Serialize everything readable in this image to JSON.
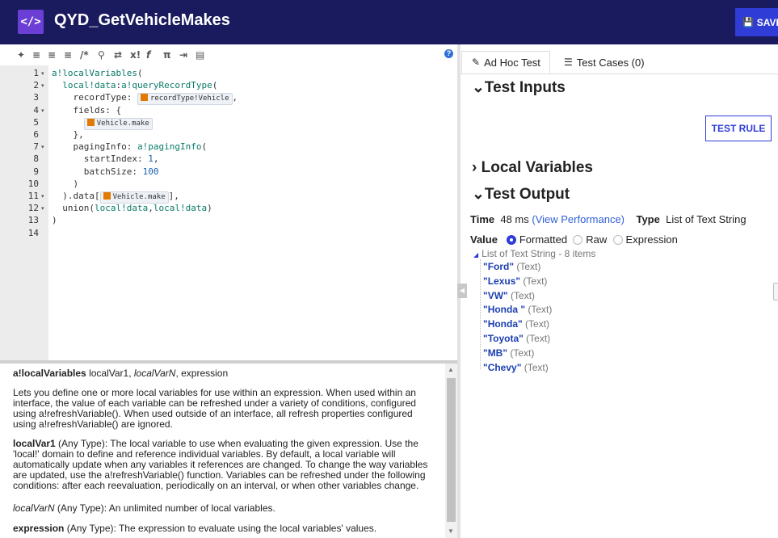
{
  "header": {
    "logo_glyph": "</>",
    "title": "QYD_GetVehicleMakes",
    "save_label": "SAVE"
  },
  "toolbar": {
    "icons": [
      "magic-wand-icon",
      "indent-icon",
      "outdent-icon",
      "list-icon",
      "comment-icon",
      "search-icon",
      "shuffle-icon",
      "variable-icon",
      "function-icon",
      "pi-icon",
      "import-icon",
      "query-icon",
      "help-icon"
    ],
    "help_glyph": "?"
  },
  "editor": {
    "lines": [
      {
        "num": "1",
        "fold": true,
        "text": "a!localVariables("
      },
      {
        "num": "2",
        "fold": true,
        "text": "  local!data:a!queryRecordType("
      },
      {
        "num": "3",
        "fold": false,
        "text": "    recordType: ",
        "chip": "recordType!Vehicle",
        "after": ","
      },
      {
        "num": "4",
        "fold": true,
        "text": "    fields: {"
      },
      {
        "num": "5",
        "fold": false,
        "text": "      ",
        "chip": "Vehicle.make",
        "after": ""
      },
      {
        "num": "6",
        "fold": false,
        "text": "    },"
      },
      {
        "num": "7",
        "fold": true,
        "text": "    pagingInfo: a!pagingInfo("
      },
      {
        "num": "8",
        "fold": false,
        "text": "      startIndex: 1,"
      },
      {
        "num": "9",
        "fold": false,
        "text": "      batchSize: 100"
      },
      {
        "num": "10",
        "fold": false,
        "text": "    )"
      },
      {
        "num": "11",
        "fold": true,
        "text": "  ).data[",
        "chip": "Vehicle.make",
        "after": "],"
      },
      {
        "num": "12",
        "fold": true,
        "text": "  union(local!data,local!data)"
      },
      {
        "num": "13",
        "fold": false,
        "text": ")"
      },
      {
        "num": "14",
        "fold": false,
        "text": ""
      }
    ]
  },
  "docs": {
    "sig_name": "a!localVariables",
    "sig_args": " localVar1, ",
    "sig_italic": "localVarN",
    "sig_rest": ", expression",
    "p1": "Lets you define one or more local variables for use within an expression. When used within an interface, the value of each variable can be refreshed under a variety of conditions, configured using a!refreshVariable(). When used outside of an interface, all refresh properties configured using a!refreshVariable() are ignored.",
    "p2_name": "localVar1",
    "p2": " (Any Type): The local variable to use when evaluating the given expression. Use the 'local!' domain to define and reference individual variables. By default, a local variable will automatically update when any variables it references are changed. To change the way variables are updated, use the a!refreshVariable() function. Variables can be refreshed under the following conditions: after each reevaluation, periodically on an interval, or when other variables change.",
    "p3_name": "localVarN",
    "p3": " (Any Type): An unlimited number of local variables.",
    "p4_name": "expression",
    "p4": " (Any Type): The expression to evaluate using the local variables' values."
  },
  "right": {
    "tab_adhoc": "Ad Hoc Test",
    "tab_cases": "Test Cases (0)",
    "test_inputs": "Test Inputs",
    "test_rule": "TEST RULE",
    "local_vars": "Local Variables",
    "test_output": "Test Output",
    "time_label": "Time",
    "time_value": "48 ms",
    "view_perf": "(View Performance)",
    "type_label": "Type",
    "type_value": "List of Text String",
    "value_label": "Value",
    "opt_formatted": "Formatted",
    "opt_raw": "Raw",
    "opt_expression": "Expression",
    "tree_title": "List of Text String - 8 items",
    "items": [
      {
        "v": "\"Ford\"",
        "t": "(Text)"
      },
      {
        "v": "\"Lexus\"",
        "t": "(Text)"
      },
      {
        "v": "\"VW\"",
        "t": "(Text)"
      },
      {
        "v": "\"Honda \"",
        "t": "(Text)"
      },
      {
        "v": "\"Honda\"",
        "t": "(Text)"
      },
      {
        "v": "\"Toyota\"",
        "t": "(Text)"
      },
      {
        "v": "\"MB\"",
        "t": "(Text)"
      },
      {
        "v": "\"Chevy\"",
        "t": "(Text)"
      }
    ]
  }
}
